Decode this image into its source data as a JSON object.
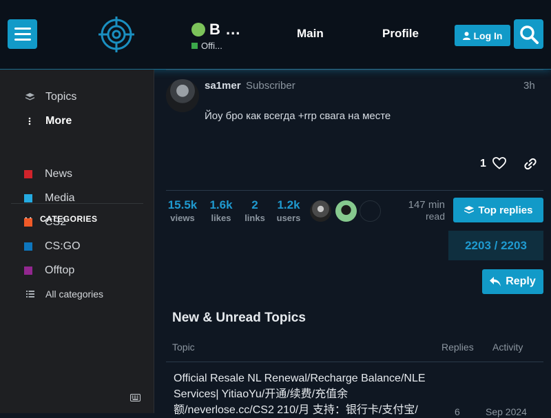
{
  "header": {
    "site_name": "B ...",
    "site_subtitle": "Offi...",
    "nav": [
      "Main",
      "Profile"
    ],
    "login_label": "Log In"
  },
  "sidebar": {
    "items": [
      {
        "label": "Topics",
        "icon": "layers-icon"
      },
      {
        "label": "More",
        "icon": "vertical-ellipsis-icon"
      }
    ],
    "categories_header": "CATEGORIES",
    "categories": [
      {
        "label": "News",
        "color": "#d0232b"
      },
      {
        "label": "Media",
        "color": "#25aae1"
      },
      {
        "label": "CS2",
        "color": "#f05a28"
      },
      {
        "label": "CS:GO",
        "color": "#0e76bd"
      },
      {
        "label": "Offtop",
        "color": "#92278f"
      }
    ],
    "all_categories": "All categories"
  },
  "post": {
    "username": "sa1mer",
    "user_title": "Subscriber",
    "time": "3h",
    "body": "Йоу бро как всегда +rrp свага на месте",
    "likes": "1"
  },
  "stats": [
    {
      "num": "15.5k",
      "label": "views"
    },
    {
      "num": "1.6k",
      "label": "likes"
    },
    {
      "num": "2",
      "label": "links"
    },
    {
      "num": "1.2k",
      "label": "users"
    }
  ],
  "read_time": {
    "value": "147 min",
    "label": "read"
  },
  "top_replies_label": "Top replies",
  "progress": "2203 / 2203",
  "reply_label": "Reply",
  "topics_section": {
    "title": "New & Unread Topics",
    "headers": {
      "topic": "Topic",
      "replies": "Replies",
      "activity": "Activity"
    },
    "rows": [
      {
        "title": "Official Resale NL Renewal/Recharge Balance/NLE Services| YitiaoYu/开通/续费/充值余额/neverlose.cc/CS2 210/月 支持：银行卡/支付宝/",
        "replies": "6",
        "activity": "Sep 2024"
      }
    ]
  },
  "colors": {
    "accent": "#129ac8",
    "stat_blue": "#1f9ad0",
    "online_green": "#7cc35a"
  }
}
